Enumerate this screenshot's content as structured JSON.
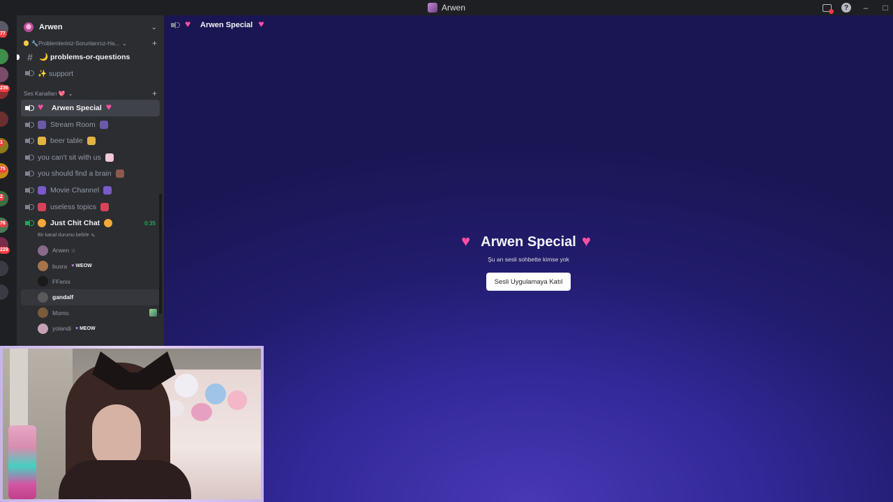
{
  "window": {
    "title": "Arwen"
  },
  "rail": {
    "badges": [
      "77",
      "236",
      "1",
      "75",
      "2",
      "76",
      "229"
    ]
  },
  "server": {
    "name": "Arwen"
  },
  "text_channels": [
    {
      "label": "🔧Problemleriniz-Sorunlarınız-Ha...",
      "type": "category-ish"
    },
    {
      "label": "🌙 problems-or-questions",
      "type": "text",
      "bright": true
    },
    {
      "label": "✨ support",
      "type": "voice"
    }
  ],
  "voice_category": {
    "label": "Ses Kanalları 💖"
  },
  "voice_channels": [
    {
      "label": "Arwen Special",
      "active": true
    },
    {
      "label": "Stream Room"
    },
    {
      "label": "beer table"
    },
    {
      "label": "you can't sit with us"
    },
    {
      "label": "you should find a brain"
    },
    {
      "label": "Movie Channel"
    },
    {
      "label": "useless topics"
    },
    {
      "label": "Just Chit Chat",
      "connected": true,
      "timer": "0:35"
    }
  ],
  "channel_status": "Bir kanal durumu belirle",
  "members": [
    {
      "name": "Arwen ☆",
      "tag": ""
    },
    {
      "name": "busra",
      "tag": "WEOW"
    },
    {
      "name": "FFenix",
      "tag": ""
    },
    {
      "name": "gandalf",
      "tag": ""
    },
    {
      "name": "Momo",
      "tag": ""
    },
    {
      "name": "yolandi",
      "tag": "MEOW"
    }
  ],
  "main": {
    "header_title": "Arwen Special",
    "center_title": "Arwen Special",
    "center_subtitle": "Şu an sesli sohbette kimse yok",
    "join_button": "Sesli Uygulamaya Katıl"
  },
  "colors": {
    "accent_green": "#23a55a",
    "badge_red": "#f23f43",
    "heart_pink": "#ff4fa3"
  }
}
